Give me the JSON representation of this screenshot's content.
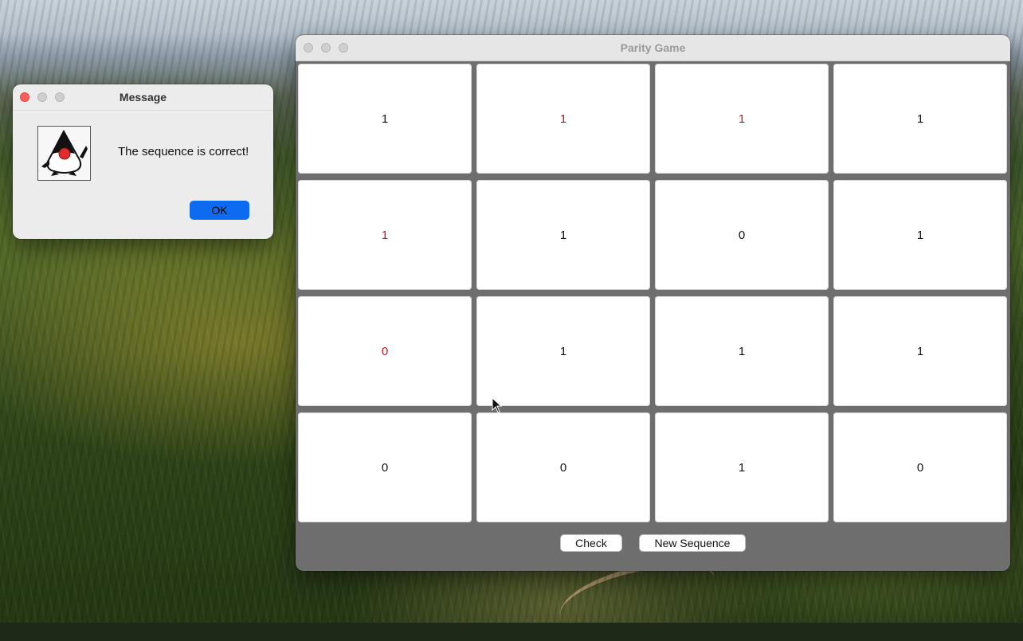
{
  "desktop": {
    "wallpaper": "forest-hills-wallpaper"
  },
  "game_window": {
    "title": "Parity Game",
    "grid": [
      [
        {
          "value": "1",
          "color": "#111111"
        },
        {
          "value": "1",
          "color": "#c8102e"
        },
        {
          "value": "1",
          "color": "#c8102e"
        },
        {
          "value": "1",
          "color": "#111111"
        }
      ],
      [
        {
          "value": "1",
          "color": "#c8102e"
        },
        {
          "value": "1",
          "color": "#111111"
        },
        {
          "value": "0",
          "color": "#111111"
        },
        {
          "value": "1",
          "color": "#111111"
        }
      ],
      [
        {
          "value": "0",
          "color": "#c8102e"
        },
        {
          "value": "1",
          "color": "#111111"
        },
        {
          "value": "1",
          "color": "#111111"
        },
        {
          "value": "1",
          "color": "#111111"
        }
      ],
      [
        {
          "value": "0",
          "color": "#111111"
        },
        {
          "value": "0",
          "color": "#111111"
        },
        {
          "value": "1",
          "color": "#111111"
        },
        {
          "value": "0",
          "color": "#111111"
        }
      ]
    ],
    "buttons": {
      "check": "Check",
      "new_sequence": "New Sequence"
    }
  },
  "message_dialog": {
    "title": "Message",
    "text": "The sequence is correct!",
    "ok_label": "OK",
    "icon": "java-duke-icon"
  },
  "colors": {
    "close": "#ff5f57",
    "inactive_traffic": "#cfcfcf",
    "ok_button": "#0b6cf2",
    "highlight_text": "#c8102e"
  }
}
